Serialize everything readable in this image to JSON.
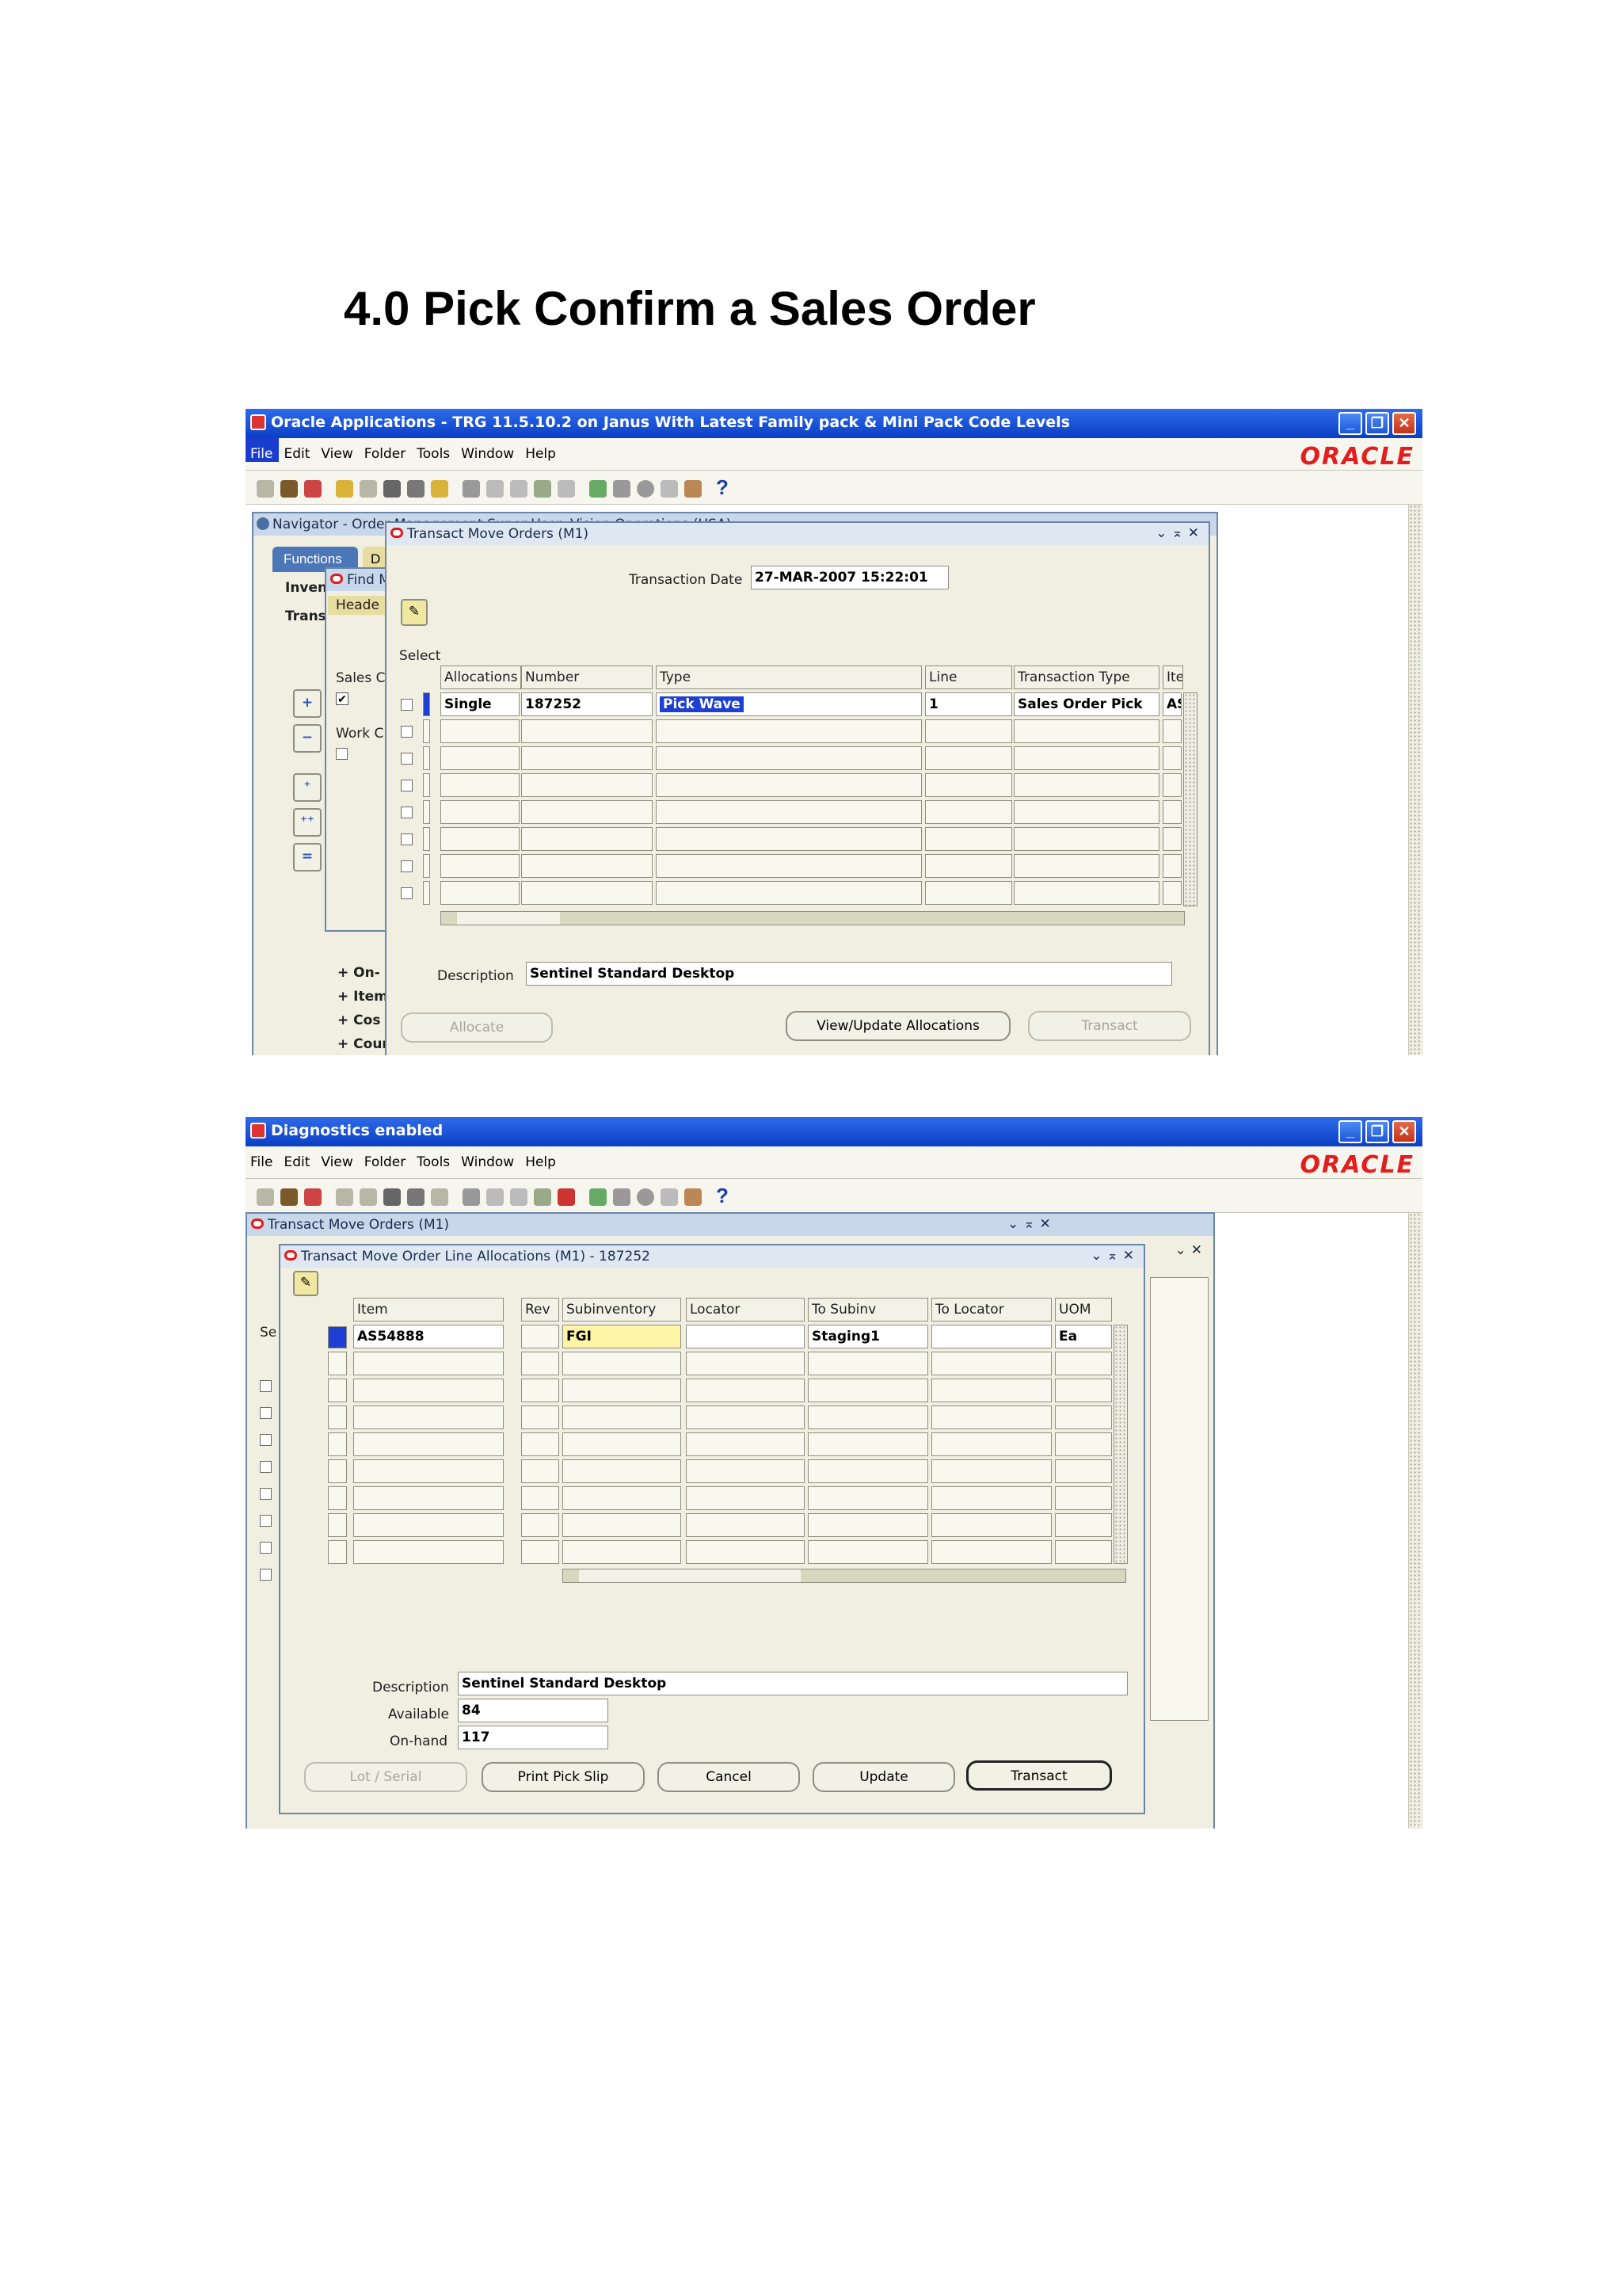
{
  "heading": "4.0 Pick Confirm a Sales Order",
  "screenshot1": {
    "app_title": "Oracle Applications - TRG 11.5.10.2 on Janus With Latest Family pack & Mini Pack Code Levels",
    "brand": "ORACLE",
    "menu": [
      "File",
      "Edit",
      "View",
      "Folder",
      "Tools",
      "Window",
      "Help"
    ],
    "navigator": {
      "title": "Navigator - Order Management Super User, Vision Operations (USA)",
      "tab_functions": "Functions",
      "tab_d": "D",
      "inv": "Inven",
      "trans": "Trans",
      "tree_items": [
        "On-",
        "Item",
        "Cos",
        "Counting"
      ]
    },
    "find_window": {
      "title": "Find M",
      "header_tab": "Heade",
      "sales_label": "Sales C",
      "work_label": "Work C"
    },
    "transact_window": {
      "title": "Transact Move Orders (M1)",
      "transaction_date_label": "Transaction Date",
      "transaction_date": "27-MAR-2007 15:22:01",
      "select_label": "Select",
      "columns": [
        "Allocations",
        "Number",
        "Type",
        "Line",
        "Transaction Type",
        "Ite"
      ],
      "row": {
        "allocations": "Single",
        "number": "187252",
        "type": "Pick Wave",
        "line": "1",
        "transaction_type": "Sales Order Pick",
        "item": "AS"
      },
      "description_label": "Description",
      "description": "Sentinel Standard Desktop",
      "buttons": {
        "allocate": "Allocate",
        "view_update": "View/Update Allocations",
        "transact": "Transact"
      }
    }
  },
  "screenshot2": {
    "app_title": "Diagnostics enabled",
    "brand": "ORACLE",
    "menu": [
      "File",
      "Edit",
      "View",
      "Folder",
      "Tools",
      "Window",
      "Help"
    ],
    "bg_window_title": "Transact Move Orders (M1)",
    "bg_select": "Se",
    "alloc_window": {
      "title": "Transact Move Order Line Allocations (M1) - 187252",
      "columns": [
        "Item",
        "Rev",
        "Subinventory",
        "Locator",
        "To Subinv",
        "To Locator",
        "UOM"
      ],
      "row": {
        "item": "AS54888",
        "rev": "",
        "subinventory": "FGI",
        "locator": "",
        "to_subinv": "Staging1",
        "to_locator": "",
        "uom": "Ea"
      },
      "description_label": "Description",
      "description": "Sentinel Standard Desktop",
      "available_label": "Available",
      "available": "84",
      "onhand_label": "On-hand",
      "onhand": "117",
      "buttons": {
        "lot_serial": "Lot / Serial",
        "print_pick_slip": "Print Pick Slip",
        "cancel": "Cancel",
        "update": "Update",
        "transact": "Transact"
      }
    }
  },
  "colors": {
    "titlebar": "#0a3fc4",
    "oracle_red": "#e31e1e",
    "form_bg": "#f0efe1",
    "highlight": "#1d3fd2",
    "required_yellow": "#fcf5a6"
  }
}
